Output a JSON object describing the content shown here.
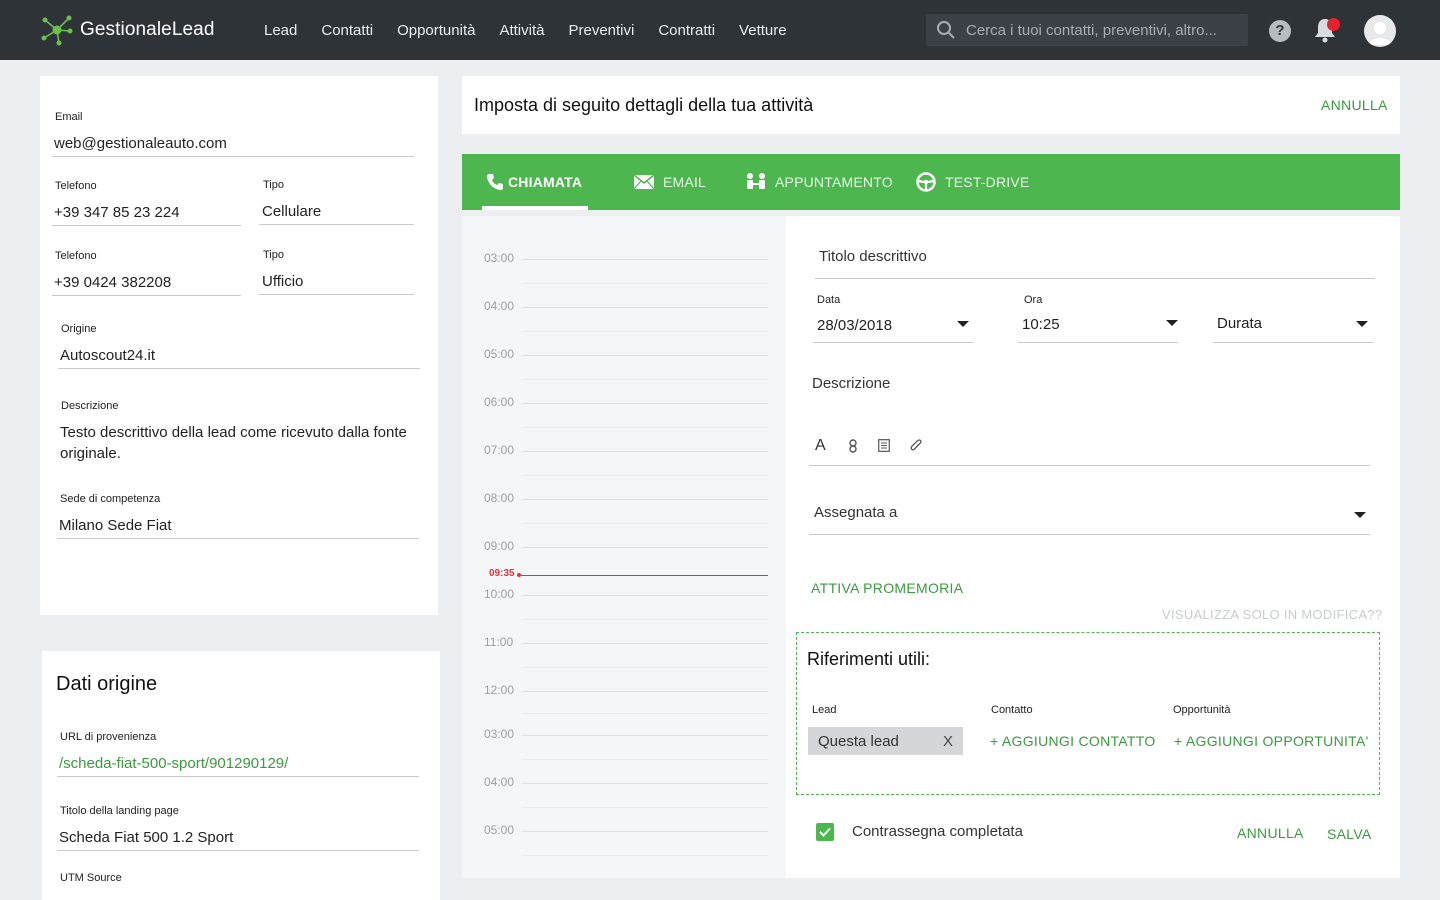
{
  "app": {
    "name": "GestionaleLead",
    "nav": [
      "Lead",
      "Contatti",
      "Opportunità",
      "Attività",
      "Preventivi",
      "Contratti",
      "Vetture"
    ],
    "search_placeholder": "Cerca i tuoi contatti, preventivi, altro...",
    "help": "?"
  },
  "contact": {
    "email_label": "Email",
    "email": "web@gestionaleauto.com",
    "phone1_label": "Telefono",
    "phone1": "+39 347 85 23 224",
    "type1_label": "Tipo",
    "type1": "Cellulare",
    "phone2_label": "Telefono",
    "phone2": "+39 0424 382208",
    "type2_label": "Tipo",
    "type2": "Ufficio",
    "origin_label": "Origine",
    "origin": "Autoscout24.it",
    "desc_label": "Descrizione",
    "desc_line1": "Testo descrittivo della lead come ricevuto dalla fonte",
    "desc_line2": "originale.",
    "site_label": "Sede di competenza",
    "site": "Milano Sede Fiat"
  },
  "origin_data": {
    "title": "Dati origine",
    "url_label": "URL di provenienza",
    "url": "/scheda-fiat-500-sport/901290129/",
    "landing_label": "Titolo della landing page",
    "landing": "Scheda Fiat 500 1.2 Sport",
    "utm_label": "UTM Source"
  },
  "activity": {
    "title": "Imposta di seguito dettagli della tua attività",
    "cancel": "ANNULLA",
    "tabs": [
      "CHIAMATA",
      "EMAIL",
      "APPUNTAMENTO",
      "TEST-DRIVE"
    ],
    "active_tab": "CHIAMATA"
  },
  "calendar": {
    "hours": [
      "03:00",
      "04:00",
      "05:00",
      "06:00",
      "07:00",
      "08:00",
      "09:00",
      "10:00",
      "11:00",
      "12:00",
      "03:00",
      "04:00",
      "05:00"
    ],
    "now": "09:35",
    "now_color": "#e0353b"
  },
  "form": {
    "title_placeholder": "Titolo descrittivo",
    "date_label": "Data",
    "date": "28/03/2018",
    "time_label": "Ora",
    "time": "10:25",
    "duration": "Durata",
    "description": "Descrizione",
    "toolbar": [
      "A",
      "link-icon",
      "list-icon",
      "attach-icon"
    ],
    "assigned": "Assegnata a",
    "reminder": "ATTIVA PROMEMORIA",
    "edit_only": "VISUALIZZA SOLO IN MODIFICA??",
    "refs_title": "Riferimenti utili:",
    "refs_lead_label": "Lead",
    "refs_lead_chip": "Questa lead",
    "refs_chip_remove": "X",
    "refs_contact_label": "Contatto",
    "refs_add_contact": "+ AGGIUNGI CONTATTO",
    "refs_opp_label": "Opportunità",
    "refs_add_opp": "+ AGGIUNGI OPPORTUNITA'",
    "mark_done": "Contrassegna completata",
    "cancel": "ANNULLA",
    "save": "SALVA"
  },
  "colors": {
    "accent": "#4db64f",
    "accent_text": "#3a9a3e",
    "topbar": "#2e3338"
  }
}
